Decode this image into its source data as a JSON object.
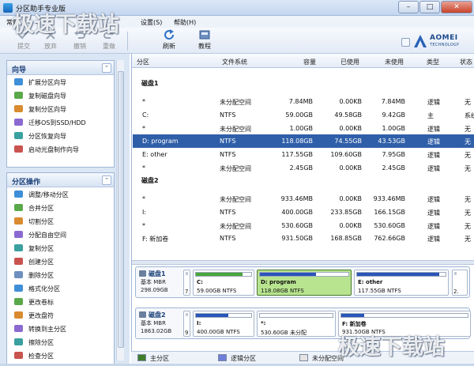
{
  "window": {
    "title": "分区助手专业版"
  },
  "menu": [
    {
      "label": "常规"
    },
    {
      "label": "设置(S)"
    },
    {
      "label": "帮助(H)"
    }
  ],
  "toolbar": {
    "buttons": [
      {
        "label": "提交",
        "icon": "submit-icon",
        "enabled": false
      },
      {
        "label": "放弃",
        "icon": "discard-icon",
        "enabled": false
      },
      {
        "label": "撤销",
        "icon": "undo-icon",
        "enabled": false
      },
      {
        "label": "重做",
        "icon": "redo-icon",
        "enabled": false
      },
      {
        "label": "刷新",
        "icon": "refresh-icon",
        "enabled": true
      },
      {
        "label": "教程",
        "icon": "tutorial-icon",
        "enabled": true
      }
    ],
    "brand": {
      "name": "AOMEI",
      "sub": "TECHNOLOGY"
    }
  },
  "wizards": {
    "title": "向导",
    "items": [
      {
        "label": "扩展分区向导"
      },
      {
        "label": "复制磁盘向导"
      },
      {
        "label": "复制分区向导"
      },
      {
        "label": "迁移OS到SSD/HDD"
      },
      {
        "label": "分区恢复向导"
      },
      {
        "label": "启动光盘制作向导"
      }
    ]
  },
  "operations": {
    "title": "分区操作",
    "items": [
      {
        "label": "调整/移动分区"
      },
      {
        "label": "合并分区"
      },
      {
        "label": "切割分区"
      },
      {
        "label": "分配自由空间"
      },
      {
        "label": "复制分区"
      },
      {
        "label": "创建分区"
      },
      {
        "label": "删除分区"
      },
      {
        "label": "格式化分区"
      },
      {
        "label": "更改卷标"
      },
      {
        "label": "更改盘符"
      },
      {
        "label": "转换到主分区"
      },
      {
        "label": "擦除分区"
      },
      {
        "label": "检查分区"
      }
    ]
  },
  "table": {
    "columns": [
      "分区",
      "文件系统",
      "容量",
      "已使用",
      "未使用",
      "类型",
      "状态"
    ],
    "disks": [
      {
        "name": "磁盘1",
        "rows": [
          {
            "part": "*",
            "fs": "未分配空间",
            "cap": "7.84MB",
            "used": "0.00KB",
            "free": "7.84MB",
            "type": "逻辑",
            "status": "无"
          },
          {
            "part": "C:",
            "fs": "NTFS",
            "cap": "59.00GB",
            "used": "49.58GB",
            "free": "9.42GB",
            "type": "主",
            "status": "系统"
          },
          {
            "part": "*",
            "fs": "未分配空间",
            "cap": "1.00GB",
            "used": "0.00KB",
            "free": "1.00GB",
            "type": "逻辑",
            "status": "无"
          },
          {
            "part": "D: program",
            "fs": "NTFS",
            "cap": "118.08GB",
            "used": "74.55GB",
            "free": "43.53GB",
            "type": "逻辑",
            "status": "无",
            "selected": true
          },
          {
            "part": "E: other",
            "fs": "NTFS",
            "cap": "117.55GB",
            "used": "109.60GB",
            "free": "7.95GB",
            "type": "逻辑",
            "status": "无"
          },
          {
            "part": "*",
            "fs": "未分配空间",
            "cap": "2.45GB",
            "used": "0.00KB",
            "free": "2.45GB",
            "type": "逻辑",
            "status": "无"
          }
        ]
      },
      {
        "name": "磁盘2",
        "rows": [
          {
            "part": "*",
            "fs": "未分配空间",
            "cap": "933.46MB",
            "used": "0.00KB",
            "free": "933.46MB",
            "type": "逻辑",
            "status": "无"
          },
          {
            "part": "I:",
            "fs": "NTFS",
            "cap": "400.00GB",
            "used": "233.85GB",
            "free": "166.15GB",
            "type": "逻辑",
            "status": "无"
          },
          {
            "part": "*",
            "fs": "未分配空间",
            "cap": "530.60GB",
            "used": "0.00KB",
            "free": "530.60GB",
            "type": "逻辑",
            "status": "无"
          },
          {
            "part": "F: 新加卷",
            "fs": "NTFS",
            "cap": "931.50GB",
            "used": "168.85GB",
            "free": "762.66GB",
            "type": "逻辑",
            "status": "无"
          }
        ]
      }
    ]
  },
  "diskmap": [
    {
      "name": "磁盘1",
      "type": "基本 MBR",
      "size": "298.09GB",
      "mini_label": "7",
      "parts": [
        {
          "name": "C:",
          "info": "59.00GB NTFS",
          "usage": 0.84
        },
        {
          "name": "D: program",
          "info": "118.08GB NTFS",
          "usage": 0.63,
          "selected": true
        },
        {
          "name": "E: other",
          "info": "117.55GB NTFS",
          "usage": 0.93
        }
      ],
      "mini_right": "2."
    },
    {
      "name": "磁盘2",
      "type": "基本 MBR",
      "size": "1863.02GB",
      "mini_label": "9",
      "parts": [
        {
          "name": "I:",
          "info": "400.00GB NTFS",
          "usage": 0.58
        },
        {
          "name": "*:",
          "info": "530.60GB 未分配",
          "usage": 0
        },
        {
          "name": "F: 新加卷",
          "info": "931.50GB NTFS",
          "usage": 0.18
        }
      ]
    }
  ],
  "legend": [
    {
      "label": "主分区",
      "color": "#3e7e2a"
    },
    {
      "label": "逻辑分区",
      "color": "#6f7ed9"
    },
    {
      "label": "未分配空间",
      "color": "#e4e4e4"
    }
  ],
  "watermark": {
    "text": "极速下载站"
  },
  "colors": {
    "selected_row": "#2f5fa8",
    "used_primary": "#4aa63a",
    "used_logical": "#2a54b8"
  }
}
